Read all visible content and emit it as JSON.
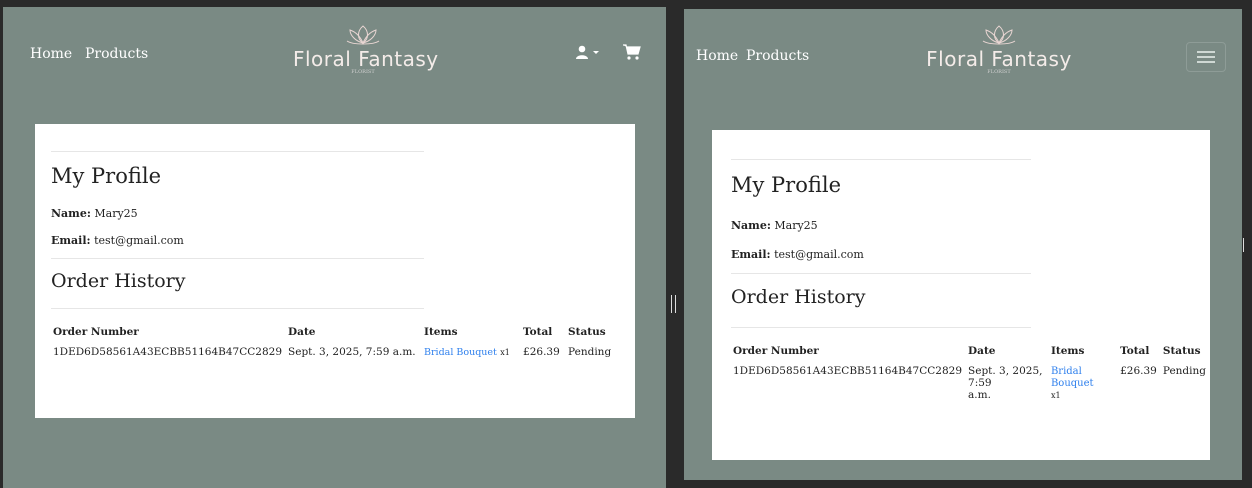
{
  "nav": {
    "home": "Home",
    "products": "Products"
  },
  "brand": {
    "name": "Floral Fantasy",
    "tagline": "FLORIST"
  },
  "profile": {
    "title": "My Profile",
    "name_label": "Name:",
    "name_value": "Mary25",
    "email_label": "Email:",
    "email_value": "test@gmail.com"
  },
  "orders": {
    "title": "Order History",
    "headers": [
      "Order Number",
      "Date",
      "Items",
      "Total",
      "Status"
    ],
    "rows": [
      {
        "number": "1DED6D58561A43ECBB51164B47CC2829",
        "date": "Sept. 3, 2025, 7:59 a.m.",
        "date_line1": "Sept. 3, 2025, 7:59",
        "date_line2": "a.m.",
        "item": "Bridal Bouquet",
        "qty": "x1",
        "total": "£26.39",
        "status": "Pending"
      }
    ]
  },
  "icons": {
    "user": "user-icon",
    "cart": "cart-icon",
    "menu": "hamburger-menu-icon"
  },
  "colors": {
    "background": "#7a8a84",
    "link": "#2f80ed",
    "card": "#ffffff"
  }
}
